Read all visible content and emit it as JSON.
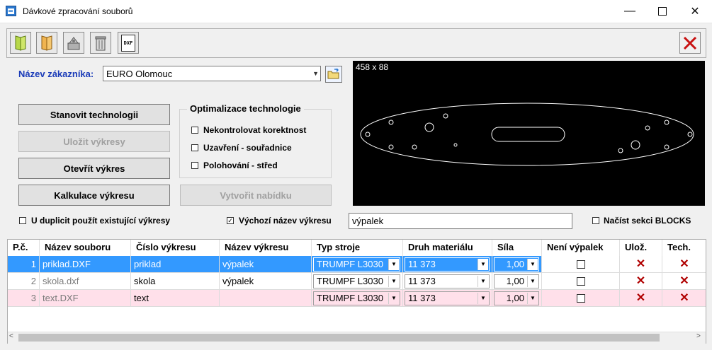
{
  "window": {
    "title": "Dávkové zpracování souborů"
  },
  "toolbar": {
    "dxf_label": "DXF"
  },
  "customer": {
    "label": "Název zákazníka:",
    "value": "EURO Olomouc"
  },
  "buttons": {
    "set_technology": "Stanovit technologii",
    "save_drawings": "Uložit výkresy",
    "open_drawing": "Otevřít výkres",
    "calc_drawing": "Kalkulace výkresu",
    "create_offer": "Vytvořit nabídku"
  },
  "optimization": {
    "title": "Optimalizace technologie",
    "options": [
      {
        "label": "Nekontrolovat korektnost",
        "checked": false
      },
      {
        "label": "Uzavření - souřadnice",
        "checked": false
      },
      {
        "label": "Polohování - střed",
        "checked": false
      }
    ]
  },
  "preview": {
    "dims": "458 x 88"
  },
  "options_row": {
    "use_existing": {
      "label": "U duplicit použít existující výkresy",
      "checked": false
    },
    "default_name": {
      "label": "Výchozí název výkresu",
      "checked": true,
      "value": "výpalek"
    },
    "load_blocks": {
      "label": "Načíst sekci BLOCKS",
      "checked": false
    }
  },
  "colors": {
    "selection": "#3399ff",
    "pink_row": "#ffe0ea",
    "label_blue": "#1a3bb8",
    "x_red": "#b00000"
  },
  "table": {
    "columns": [
      "P.č.",
      "Název souboru",
      "Číslo výkresu",
      "Název výkresu",
      "Typ stroje",
      "Druh materiálu",
      "Síla",
      "Není výpalek",
      "Ulož.",
      "Tech."
    ],
    "rows": [
      {
        "pc": "1",
        "file": "priklad.DXF",
        "number": "priklad",
        "name": "výpalek",
        "machine": "TRUMPF L3030",
        "material": "11 373",
        "thickness": "1,00",
        "style": "sel"
      },
      {
        "pc": "2",
        "file": "skola.dxf",
        "number": "skola",
        "name": "výpalek",
        "machine": "TRUMPF L3030",
        "material": "11 373",
        "thickness": "1,00",
        "style": "gray"
      },
      {
        "pc": "3",
        "file": "text.DXF",
        "number": "text",
        "name": "",
        "machine": "TRUMPF L3030",
        "material": "11 373",
        "thickness": "1,00",
        "style": "pink"
      }
    ]
  }
}
